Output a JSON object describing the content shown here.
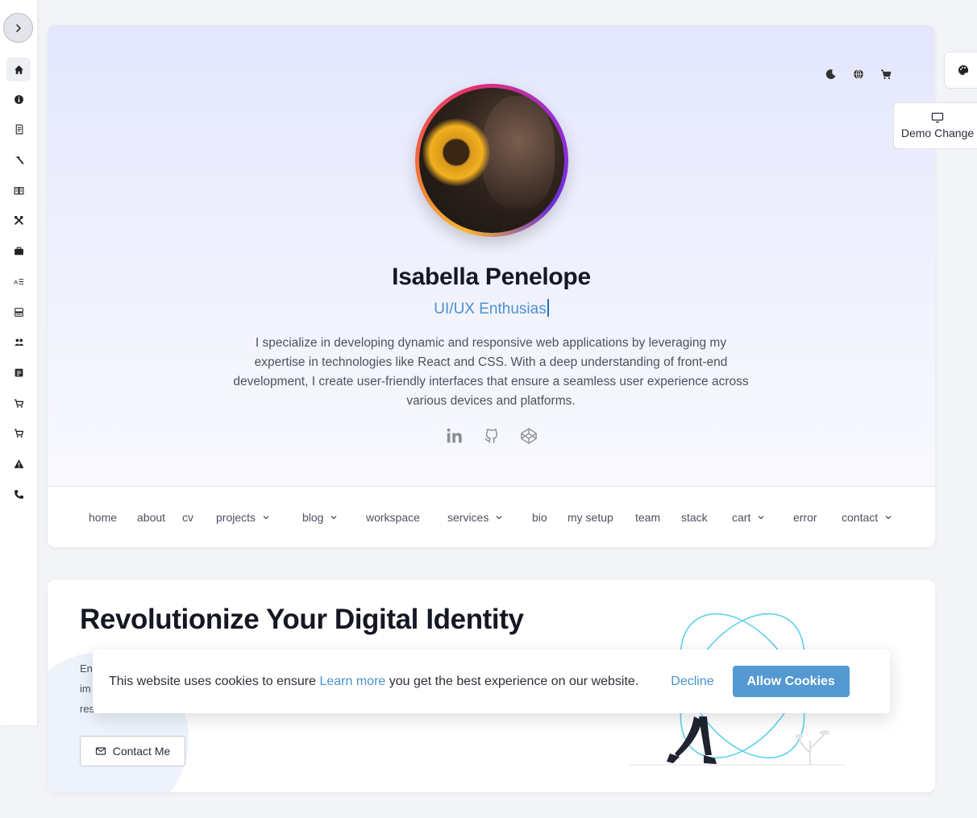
{
  "sidebar": {
    "toggle_icon": "chevron-right-icon",
    "items": [
      {
        "icon": "home-icon",
        "active": true
      },
      {
        "icon": "info-icon"
      },
      {
        "icon": "document-icon"
      },
      {
        "icon": "hammer-icon"
      },
      {
        "icon": "book-icon"
      },
      {
        "icon": "tools-icon"
      },
      {
        "icon": "briefcase-icon"
      },
      {
        "icon": "bio-icon"
      },
      {
        "icon": "server-icon"
      },
      {
        "icon": "team-icon"
      },
      {
        "icon": "blog-icon"
      },
      {
        "icon": "cart-icon"
      },
      {
        "icon": "cart-icon"
      },
      {
        "icon": "warning-icon"
      },
      {
        "icon": "phone-icon"
      }
    ]
  },
  "hero": {
    "tools": [
      "moon-icon",
      "globe-icon",
      "cart-icon"
    ],
    "name": "Isabella Penelope",
    "role": "UI/UX Enthusias",
    "bio": "I specialize in developing dynamic and responsive web applications by leveraging my expertise in technologies like React and CSS. With a deep understanding of front-end development, I create user-friendly interfaces that ensure a seamless user experience across various devices and platforms.",
    "socials": [
      "linkedin-icon",
      "github-icon",
      "codepen-icon"
    ]
  },
  "menu": {
    "items": [
      {
        "label": "home"
      },
      {
        "label": "about"
      },
      {
        "label": "cv"
      },
      {
        "label": "projects",
        "dropdown": true
      },
      {
        "label": "blog",
        "dropdown": true
      },
      {
        "label": "workspace"
      },
      {
        "label": "services",
        "dropdown": true
      },
      {
        "label": "bio"
      },
      {
        "label": "my setup"
      },
      {
        "label": "team"
      },
      {
        "label": "stack"
      },
      {
        "label": "cart",
        "dropdown": true
      },
      {
        "label": "error"
      },
      {
        "label": "contact",
        "dropdown": true
      }
    ]
  },
  "floating": {
    "palette_icon": "palette-icon",
    "demo_label": "Demo Change"
  },
  "section2": {
    "title": "Revolutionize Your Digital Identity",
    "text_lines": [
      "En",
      "im",
      "res"
    ],
    "contact_label": "Contact Me"
  },
  "cookie": {
    "text_before": "This website uses cookies to ensure ",
    "link": "Learn more",
    "text_after": " you get the best experience on our website.",
    "decline": "Decline",
    "allow": "Allow Cookies"
  },
  "colors": {
    "accent": "#4a92cf",
    "allow_button": "#5499d1",
    "hero_gradient_top": "#e3e6fd"
  }
}
